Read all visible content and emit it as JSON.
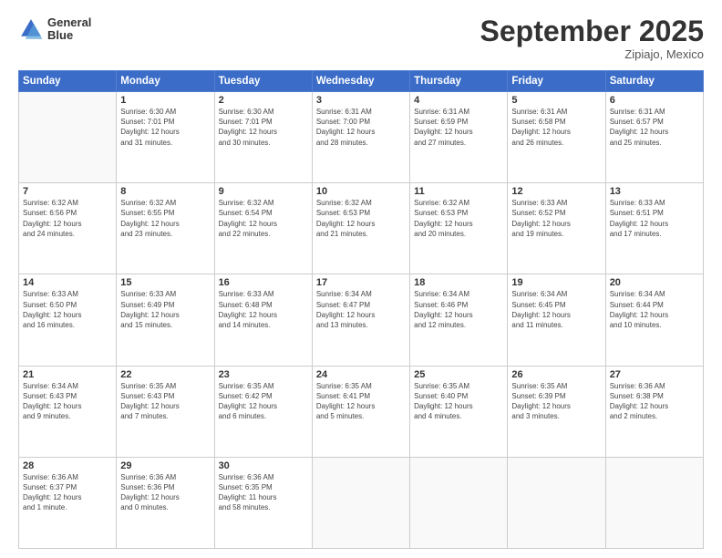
{
  "header": {
    "logo_line1": "General",
    "logo_line2": "Blue",
    "month": "September 2025",
    "location": "Zipiajo, Mexico"
  },
  "weekdays": [
    "Sunday",
    "Monday",
    "Tuesday",
    "Wednesday",
    "Thursday",
    "Friday",
    "Saturday"
  ],
  "weeks": [
    [
      {
        "day": "",
        "info": ""
      },
      {
        "day": "1",
        "info": "Sunrise: 6:30 AM\nSunset: 7:01 PM\nDaylight: 12 hours\nand 31 minutes."
      },
      {
        "day": "2",
        "info": "Sunrise: 6:30 AM\nSunset: 7:01 PM\nDaylight: 12 hours\nand 30 minutes."
      },
      {
        "day": "3",
        "info": "Sunrise: 6:31 AM\nSunset: 7:00 PM\nDaylight: 12 hours\nand 28 minutes."
      },
      {
        "day": "4",
        "info": "Sunrise: 6:31 AM\nSunset: 6:59 PM\nDaylight: 12 hours\nand 27 minutes."
      },
      {
        "day": "5",
        "info": "Sunrise: 6:31 AM\nSunset: 6:58 PM\nDaylight: 12 hours\nand 26 minutes."
      },
      {
        "day": "6",
        "info": "Sunrise: 6:31 AM\nSunset: 6:57 PM\nDaylight: 12 hours\nand 25 minutes."
      }
    ],
    [
      {
        "day": "7",
        "info": "Sunrise: 6:32 AM\nSunset: 6:56 PM\nDaylight: 12 hours\nand 24 minutes."
      },
      {
        "day": "8",
        "info": "Sunrise: 6:32 AM\nSunset: 6:55 PM\nDaylight: 12 hours\nand 23 minutes."
      },
      {
        "day": "9",
        "info": "Sunrise: 6:32 AM\nSunset: 6:54 PM\nDaylight: 12 hours\nand 22 minutes."
      },
      {
        "day": "10",
        "info": "Sunrise: 6:32 AM\nSunset: 6:53 PM\nDaylight: 12 hours\nand 21 minutes."
      },
      {
        "day": "11",
        "info": "Sunrise: 6:32 AM\nSunset: 6:53 PM\nDaylight: 12 hours\nand 20 minutes."
      },
      {
        "day": "12",
        "info": "Sunrise: 6:33 AM\nSunset: 6:52 PM\nDaylight: 12 hours\nand 19 minutes."
      },
      {
        "day": "13",
        "info": "Sunrise: 6:33 AM\nSunset: 6:51 PM\nDaylight: 12 hours\nand 17 minutes."
      }
    ],
    [
      {
        "day": "14",
        "info": "Sunrise: 6:33 AM\nSunset: 6:50 PM\nDaylight: 12 hours\nand 16 minutes."
      },
      {
        "day": "15",
        "info": "Sunrise: 6:33 AM\nSunset: 6:49 PM\nDaylight: 12 hours\nand 15 minutes."
      },
      {
        "day": "16",
        "info": "Sunrise: 6:33 AM\nSunset: 6:48 PM\nDaylight: 12 hours\nand 14 minutes."
      },
      {
        "day": "17",
        "info": "Sunrise: 6:34 AM\nSunset: 6:47 PM\nDaylight: 12 hours\nand 13 minutes."
      },
      {
        "day": "18",
        "info": "Sunrise: 6:34 AM\nSunset: 6:46 PM\nDaylight: 12 hours\nand 12 minutes."
      },
      {
        "day": "19",
        "info": "Sunrise: 6:34 AM\nSunset: 6:45 PM\nDaylight: 12 hours\nand 11 minutes."
      },
      {
        "day": "20",
        "info": "Sunrise: 6:34 AM\nSunset: 6:44 PM\nDaylight: 12 hours\nand 10 minutes."
      }
    ],
    [
      {
        "day": "21",
        "info": "Sunrise: 6:34 AM\nSunset: 6:43 PM\nDaylight: 12 hours\nand 9 minutes."
      },
      {
        "day": "22",
        "info": "Sunrise: 6:35 AM\nSunset: 6:43 PM\nDaylight: 12 hours\nand 7 minutes."
      },
      {
        "day": "23",
        "info": "Sunrise: 6:35 AM\nSunset: 6:42 PM\nDaylight: 12 hours\nand 6 minutes."
      },
      {
        "day": "24",
        "info": "Sunrise: 6:35 AM\nSunset: 6:41 PM\nDaylight: 12 hours\nand 5 minutes."
      },
      {
        "day": "25",
        "info": "Sunrise: 6:35 AM\nSunset: 6:40 PM\nDaylight: 12 hours\nand 4 minutes."
      },
      {
        "day": "26",
        "info": "Sunrise: 6:35 AM\nSunset: 6:39 PM\nDaylight: 12 hours\nand 3 minutes."
      },
      {
        "day": "27",
        "info": "Sunrise: 6:36 AM\nSunset: 6:38 PM\nDaylight: 12 hours\nand 2 minutes."
      }
    ],
    [
      {
        "day": "28",
        "info": "Sunrise: 6:36 AM\nSunset: 6:37 PM\nDaylight: 12 hours\nand 1 minute."
      },
      {
        "day": "29",
        "info": "Sunrise: 6:36 AM\nSunset: 6:36 PM\nDaylight: 12 hours\nand 0 minutes."
      },
      {
        "day": "30",
        "info": "Sunrise: 6:36 AM\nSunset: 6:35 PM\nDaylight: 11 hours\nand 58 minutes."
      },
      {
        "day": "",
        "info": ""
      },
      {
        "day": "",
        "info": ""
      },
      {
        "day": "",
        "info": ""
      },
      {
        "day": "",
        "info": ""
      }
    ]
  ]
}
